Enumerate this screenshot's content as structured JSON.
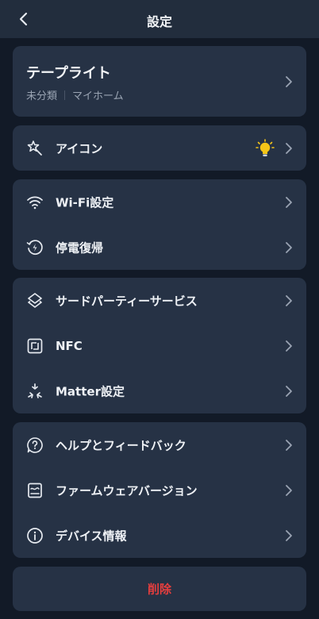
{
  "header": {
    "title": "設定"
  },
  "device": {
    "name": "テープライト",
    "category": "未分類",
    "home": "マイホーム"
  },
  "icon_row": {
    "label": "アイコン",
    "icon": "lightbulb-icon"
  },
  "group2": [
    {
      "label": "Wi-Fi設定",
      "icon": "wifi-icon"
    },
    {
      "label": "停電復帰",
      "icon": "power-restore-icon"
    }
  ],
  "group3": [
    {
      "label": "サードパーティーサービス",
      "icon": "layers-icon"
    },
    {
      "label": "NFC",
      "icon": "nfc-icon"
    },
    {
      "label": "Matter設定",
      "icon": "matter-icon"
    }
  ],
  "group4": [
    {
      "label": "ヘルプとフィードバック",
      "icon": "help-chat-icon"
    },
    {
      "label": "ファームウェアバージョン",
      "icon": "firmware-icon"
    },
    {
      "label": "デバイス情報",
      "icon": "info-icon"
    }
  ],
  "delete_label": "削除",
  "colors": {
    "background": "#121a27",
    "card": "#263245",
    "danger": "#e53e3e",
    "bulb": "#f5c518"
  }
}
